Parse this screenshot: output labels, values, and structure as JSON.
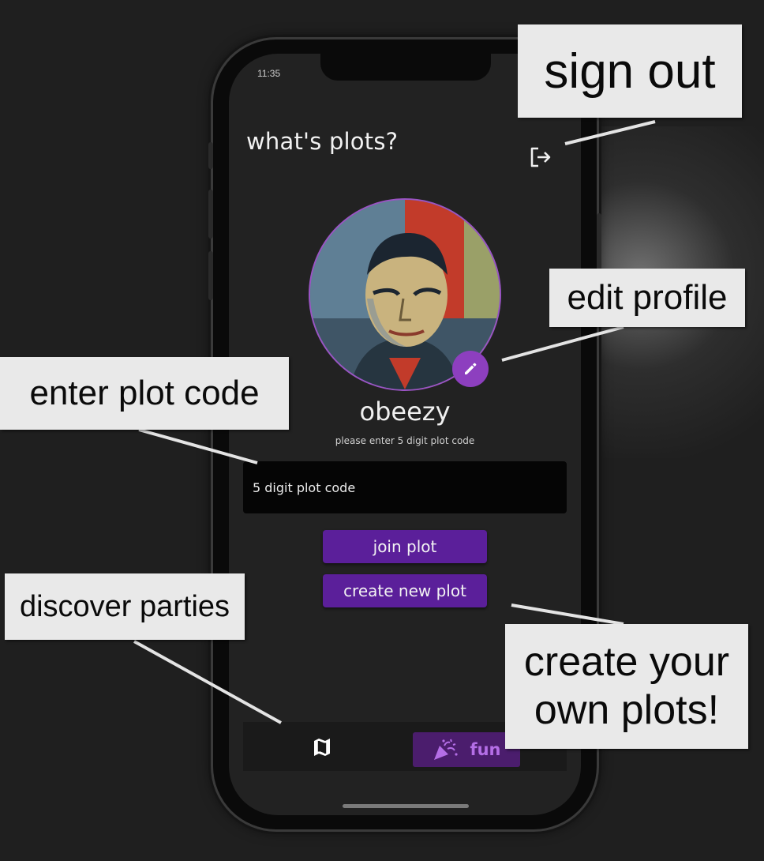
{
  "status": {
    "time": "11:35"
  },
  "app": {
    "title": "what's plots?"
  },
  "profile": {
    "username": "obeezy"
  },
  "join": {
    "hint": "please enter 5 digit plot code",
    "code_placeholder": "5 digit plot code",
    "join_label": "join plot",
    "create_label": "create new plot"
  },
  "tabbar": {
    "items": [
      {
        "icon": "map-icon",
        "label": ""
      },
      {
        "icon": "party-popper-icon",
        "label": "fun"
      }
    ]
  },
  "callouts": {
    "sign_out": "sign out",
    "edit_profile": "edit profile",
    "enter_plot_code": "enter plot code",
    "discover_parties": "discover parties",
    "create_your_own_plots": "create your own plots!"
  },
  "colors": {
    "background": "#1f1f1f",
    "accent_purple": "#5b1f9a",
    "edit_button": "#8d3fbf",
    "fun_tab_bg": "#4b1d6d",
    "fun_tab_text": "#b46ee6",
    "callout_bg": "#e9e9e9"
  }
}
